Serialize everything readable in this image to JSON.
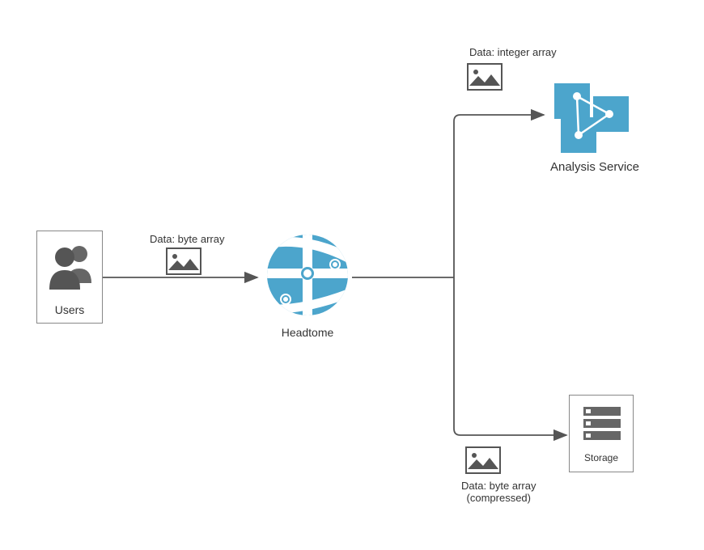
{
  "nodes": {
    "users": {
      "label": "Users"
    },
    "headtome": {
      "label": "Headtome"
    },
    "analysis": {
      "label": "Analysis Service"
    },
    "storage": {
      "label": "Storage"
    }
  },
  "edges": {
    "users_to_headtome": {
      "label": "Data: byte array"
    },
    "headtome_to_analysis": {
      "label": "Data: integer array"
    },
    "headtome_to_storage": {
      "label": "Data: byte array\n(compressed)"
    }
  }
}
